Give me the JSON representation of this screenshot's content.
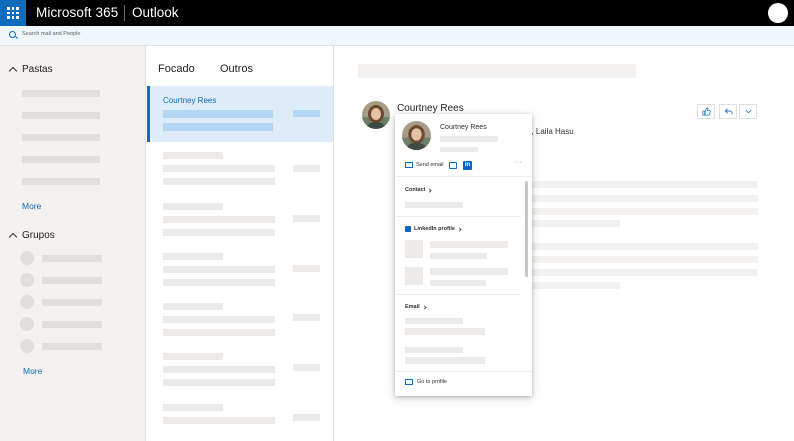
{
  "topbar": {
    "brand": "Microsoft 365",
    "app_name": "Outlook"
  },
  "search": {
    "placeholder": "Search mail and People"
  },
  "leftnav": {
    "folders_header": "Pastas",
    "folders_more": "More",
    "groups_header": "Grupos",
    "groups_more": "More"
  },
  "messagelist": {
    "tabs": [
      {
        "label": "Focado"
      },
      {
        "label": "Outros"
      }
    ],
    "selected_sender": "Courtney Rees"
  },
  "reading": {
    "sender_name": "Courtney Rees",
    "recipients_visible": "n, Laila Hasu"
  },
  "profile_card": {
    "name": "Courtney Rees",
    "send_email": "Send email",
    "more_glyph": "···",
    "contact_section": "Contact",
    "linkedin_section": "LinkedIn profile",
    "email_section": "Email",
    "go_to_profile": "Go to profile",
    "linkedin_glyph": "in"
  },
  "colors": {
    "accent": "#0f6cbd",
    "topbar": "#000000",
    "selected_row": "#deecf9",
    "linkedin": "#0a66c2"
  }
}
